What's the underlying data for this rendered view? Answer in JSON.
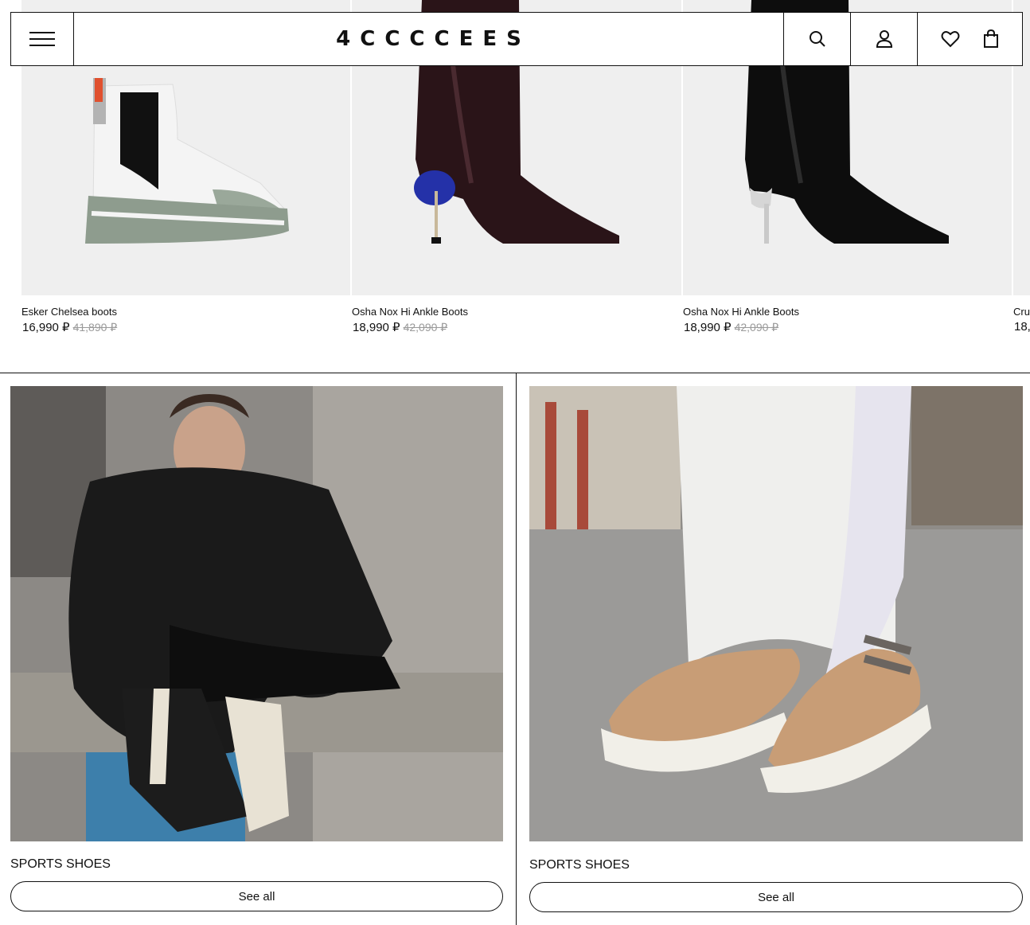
{
  "header": {
    "logo": "4CCCCEES",
    "menu_icon": "hamburger-menu-icon",
    "search_icon": "search-icon",
    "account_icon": "user-icon",
    "wishlist_icon": "heart-icon",
    "cart_icon": "shopping-bag-icon"
  },
  "products": [
    {
      "name": "Esker Chelsea boots",
      "price": "16,990 ₽",
      "old_price": "41,890 ₽"
    },
    {
      "name": "Osha Nox Hi Ankle Boots",
      "price": "18,990 ₽",
      "old_price": "42,090 ₽"
    },
    {
      "name": "Osha Nox Hi Ankle Boots",
      "price": "18,990 ₽",
      "old_price": "42,090 ₽"
    },
    {
      "name": "Cru",
      "price": "18,"
    }
  ],
  "banners": [
    {
      "caption": "SPORTS SHOES",
      "button": "See all"
    },
    {
      "caption": "SPORTS SHOES",
      "button": "See all"
    }
  ]
}
